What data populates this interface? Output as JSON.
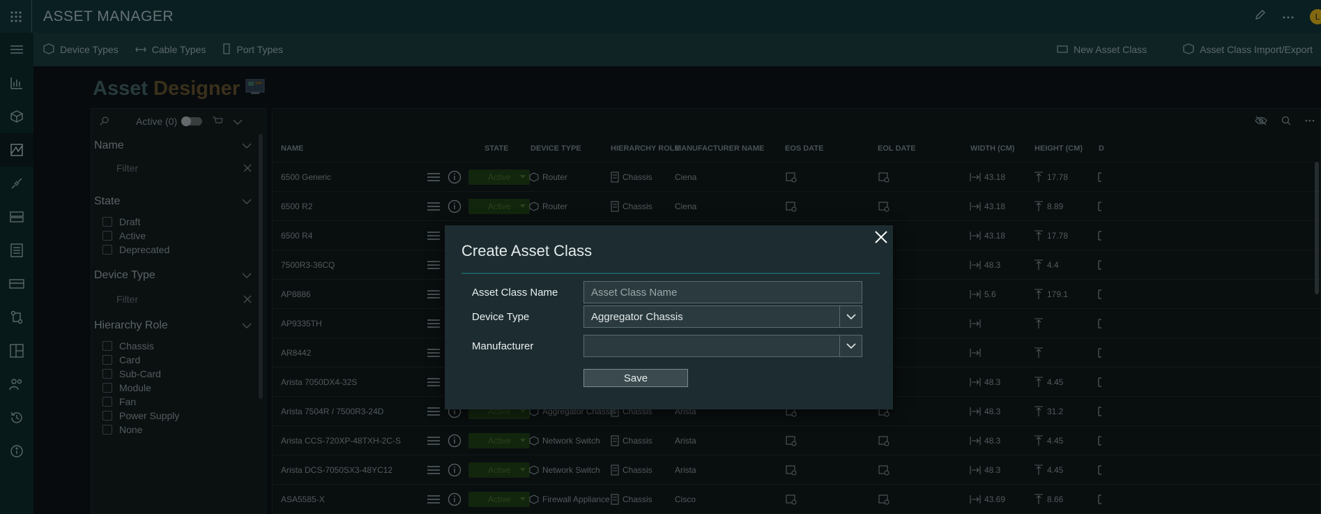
{
  "app": {
    "title": "ASSET MANAGER"
  },
  "subnav": {
    "device_types": "Device Types",
    "cable_types": "Cable Types",
    "port_types": "Port Types",
    "new_asset_class": "New Asset Class",
    "import_export": "Asset Class Import/Export"
  },
  "page": {
    "title_part1": "Asset",
    "title_part2": "Designer"
  },
  "filters": {
    "active_label": "Active (0)",
    "name_title": "Name",
    "name_filter": "Filter",
    "state_title": "State",
    "states": [
      "Draft",
      "Active",
      "Deprecated"
    ],
    "device_type_title": "Device Type",
    "device_type_filter": "Filter",
    "hierarchy_title": "Hierarchy Role",
    "hierarchy": [
      "Chassis",
      "Card",
      "Sub-Card",
      "Module",
      "Fan",
      "Power Supply",
      "None"
    ]
  },
  "table": {
    "headers": [
      "NAME",
      "STATE",
      "DEVICE TYPE",
      "HIERARCHY ROLE",
      "MANUFACTURER NAME",
      "EOS DATE",
      "EOL DATE",
      "WIDTH (CM)",
      "HEIGHT (CM)",
      "D"
    ],
    "rows": [
      {
        "name": "6500 Generic",
        "state": "Active",
        "device": "Router",
        "role": "Chassis",
        "mfr": "Ciena",
        "width": "43.18",
        "height": "17.78"
      },
      {
        "name": "6500 R2",
        "state": "Active",
        "device": "Router",
        "role": "Chassis",
        "mfr": "Ciena",
        "width": "43.18",
        "height": "8.89"
      },
      {
        "name": "6500 R4",
        "state": "",
        "device": "",
        "role": "",
        "mfr": "",
        "width": "43.18",
        "height": "17.78"
      },
      {
        "name": "7500R3-36CQ",
        "state": "",
        "device": "",
        "role": "",
        "mfr": "",
        "width": "48.3",
        "height": "4.4"
      },
      {
        "name": "AP8886",
        "state": "",
        "device": "",
        "role": "",
        "mfr": "",
        "width": "5.6",
        "height": "179.1"
      },
      {
        "name": "AP9335TH",
        "state": "",
        "device": "",
        "role": "",
        "mfr": "",
        "width": "",
        "height": ""
      },
      {
        "name": "AR8442",
        "state": "",
        "device": "",
        "role": "",
        "mfr": "",
        "width": "",
        "height": ""
      },
      {
        "name": "Arista 7050DX4-32S",
        "state": "",
        "device": "",
        "role": "",
        "mfr": "",
        "width": "48.3",
        "height": "4.45"
      },
      {
        "name": "Arista 7504R / 7500R3-24D",
        "state": "Active",
        "device": "Aggregator Chassis",
        "role": "Chassis",
        "mfr": "Arista",
        "width": "48.3",
        "height": "31.2"
      },
      {
        "name": "Arista CCS-720XP-48TXH-2C-S",
        "state": "Active",
        "device": "Network Switch",
        "role": "Chassis",
        "mfr": "Arista",
        "width": "48.3",
        "height": "4.45"
      },
      {
        "name": "Arista DCS-7050SX3-48YC12",
        "state": "Active",
        "device": "Network Switch",
        "role": "Chassis",
        "mfr": "Arista",
        "width": "48.3",
        "height": "4.45"
      },
      {
        "name": "ASA5585-X",
        "state": "Active",
        "device": "Firewall Appliance",
        "role": "Chassis",
        "mfr": "Cisco",
        "width": "43.69",
        "height": "8.66"
      }
    ]
  },
  "modal": {
    "title": "Create Asset Class",
    "name_label": "Asset Class Name",
    "name_placeholder": "Asset Class Name",
    "device_type_label": "Device Type",
    "device_type_value": "Aggregator Chassis",
    "manufacturer_label": "Manufacturer",
    "manufacturer_value": "",
    "save_label": "Save"
  },
  "user": {
    "initial": "L"
  }
}
